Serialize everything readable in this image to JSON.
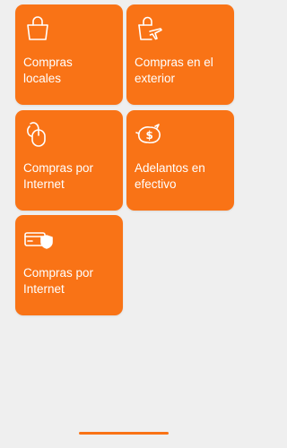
{
  "tiles": [
    {
      "label": "Compras\nlocales",
      "icon": "shopping-bag-icon"
    },
    {
      "label": "Compras en el\nexterior",
      "icon": "shopping-bag-airplane-icon"
    },
    {
      "label": "Compras por\nInternet",
      "icon": "computer-mouse-icon"
    },
    {
      "label": "Adelantos en\nefectivo",
      "icon": "piggy-bank-dollar-icon"
    },
    {
      "label": "Compras por\nInternet",
      "icon": "secure-card-icon"
    }
  ],
  "colors": {
    "accent": "#f97316",
    "background": "#efefef",
    "text_on_accent": "#ffffff"
  }
}
